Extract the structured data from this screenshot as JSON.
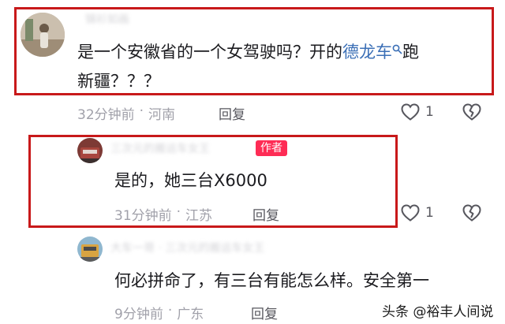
{
  "comments": [
    {
      "user_name": "锦衫如画",
      "text_line1_prefix": "是一个安徽省的一个女驾驶吗？开的",
      "text_link": "德龙车",
      "text_line1_suffix": "跑",
      "text_line2": "新疆？？？",
      "time": "32分钟前",
      "location": "河南",
      "reply_label": "回复",
      "likes": "1"
    },
    {
      "user_name": "三次元的搬运车女王",
      "author_badge": "作者",
      "text": "是的，她三台X6000",
      "time": "31分钟前",
      "location": "江苏",
      "reply_label": "回复",
      "likes": "1"
    },
    {
      "user_name": "大车一哥 · 三次元的搬运车女王",
      "text": "何必拼命了，有三台有能怎么样。安全第一",
      "time": "9分钟前",
      "location": "广东",
      "reply_label": "回复"
    }
  ],
  "separator": "·",
  "watermark": "头条 @裕丰人间说",
  "colors": {
    "highlight_border": "#c8191a",
    "link": "#3b6fb6",
    "author_badge": "#fe2c55"
  },
  "icons": [
    "search-icon",
    "heart-icon",
    "dislike-icon"
  ]
}
